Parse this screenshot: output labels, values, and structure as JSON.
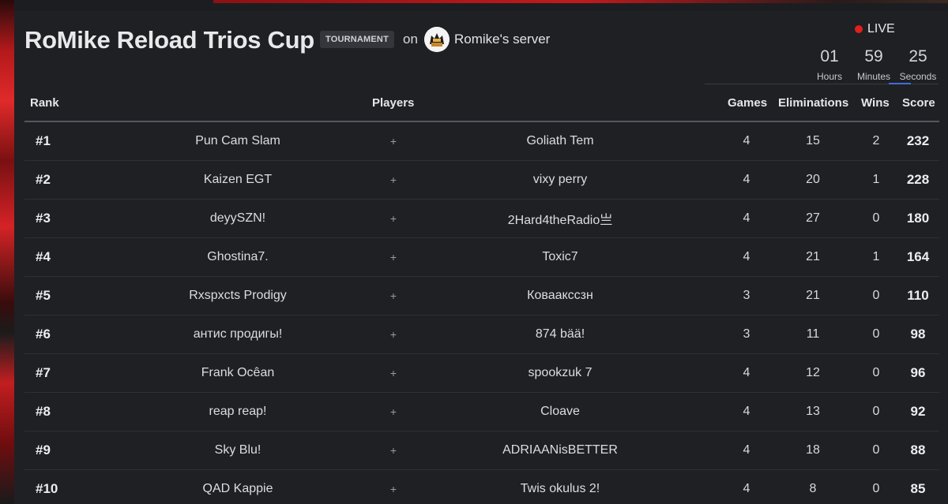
{
  "header": {
    "title": "RoMike Reload Trios Cup",
    "badge": "TOURNAMENT",
    "on_text": "on",
    "server_name": "Romike's server"
  },
  "status": {
    "live_label": "LIVE",
    "live_color": "#e0201c",
    "countdown": {
      "hours": "01",
      "hours_label": "Hours",
      "minutes": "59",
      "minutes_label": "Minutes",
      "seconds": "25",
      "seconds_label": "Seconds"
    }
  },
  "table": {
    "headers": {
      "rank": "Rank",
      "players": "Players",
      "games": "Games",
      "eliminations": "Eliminations",
      "wins": "Wins",
      "score": "Score"
    },
    "rows": [
      {
        "rank": "#1",
        "player1": "Pun Cam Slam",
        "sep": "+",
        "player2": "Goliath Tem",
        "games": "4",
        "eliminations": "15",
        "wins": "2",
        "score": "232"
      },
      {
        "rank": "#2",
        "player1": "Kaizen EGT",
        "sep": "+",
        "player2": "vixy perry",
        "games": "4",
        "eliminations": "20",
        "wins": "1",
        "score": "228"
      },
      {
        "rank": "#3",
        "player1": "deyySZN!",
        "sep": "+",
        "player2": "2Hard4theRadio亗",
        "games": "4",
        "eliminations": "27",
        "wins": "0",
        "score": "180"
      },
      {
        "rank": "#4",
        "player1": "Ghostina7.",
        "sep": "+",
        "player2": "Toxic7",
        "games": "4",
        "eliminations": "21",
        "wins": "1",
        "score": "164"
      },
      {
        "rank": "#5",
        "player1": "Rxspxcts Prodigy",
        "sep": "+",
        "player2": "Коваакссзн",
        "games": "3",
        "eliminations": "21",
        "wins": "0",
        "score": "110"
      },
      {
        "rank": "#6",
        "player1": "антис продигы!",
        "sep": "+",
        "player2": "874 bää!",
        "games": "3",
        "eliminations": "11",
        "wins": "0",
        "score": "98"
      },
      {
        "rank": "#7",
        "player1": "Frank Ocêan",
        "sep": "+",
        "player2": "spookzuk 7",
        "games": "4",
        "eliminations": "12",
        "wins": "0",
        "score": "96"
      },
      {
        "rank": "#8",
        "player1": "reap reap!",
        "sep": "+",
        "player2": "Cloave",
        "games": "4",
        "eliminations": "13",
        "wins": "0",
        "score": "92"
      },
      {
        "rank": "#9",
        "player1": "Sky Blu!",
        "sep": "+",
        "player2": "ADRIAANisBETTER",
        "games": "4",
        "eliminations": "18",
        "wins": "0",
        "score": "88"
      },
      {
        "rank": "#10",
        "player1": "QAD Kappie",
        "sep": "+",
        "player2": "Twis okulus 2!",
        "games": "4",
        "eliminations": "8",
        "wins": "0",
        "score": "85"
      }
    ]
  }
}
